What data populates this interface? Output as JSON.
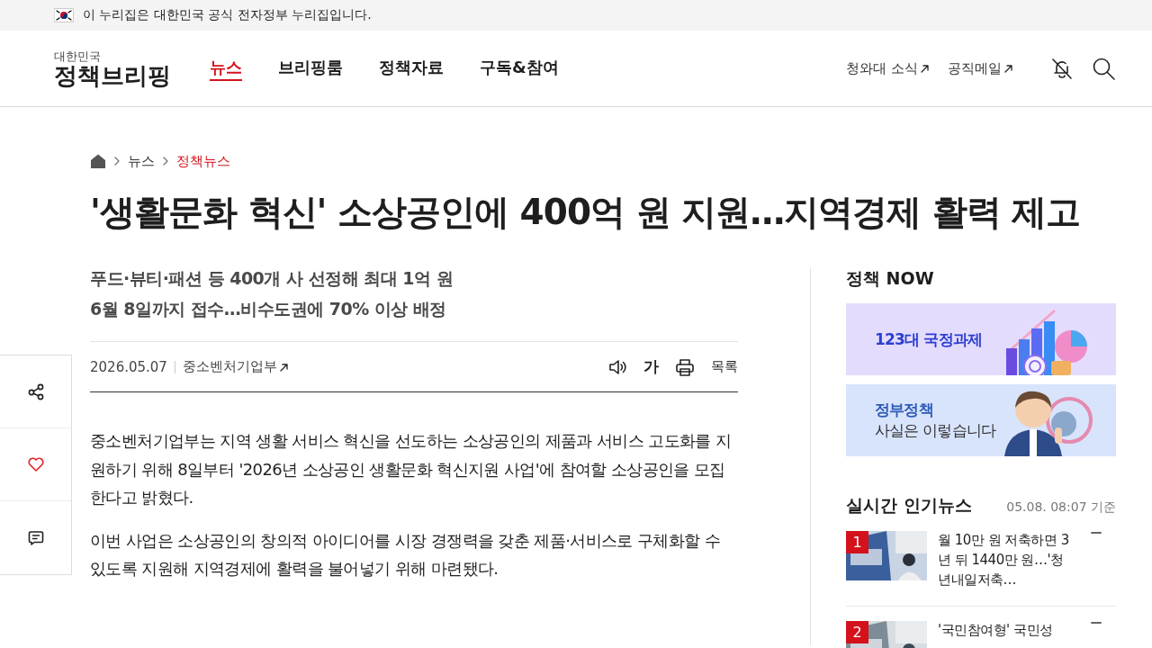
{
  "gov_banner": {
    "text": "이 누리집은 대한민국 공식 전자정부 누리집입니다."
  },
  "logo": {
    "small": "대한민국",
    "main": "정책브리핑"
  },
  "nav": [
    {
      "label": "뉴스",
      "selected": true
    },
    {
      "label": "브리핑룸",
      "selected": false
    },
    {
      "label": "정책자료",
      "selected": false
    },
    {
      "label": "구독&참여",
      "selected": false
    }
  ],
  "utility_links": [
    "청와대 소식",
    "공직메일"
  ],
  "breadcrumb": [
    {
      "label": "뉴스",
      "selected": false
    },
    {
      "label": "정책뉴스",
      "selected": true
    }
  ],
  "headline": "'생활문화 혁신' 소상공인에 400억 원 지원…지역경제 활력 제고",
  "subheadlines": [
    "푸드·뷰티·패션 등 400개 사 선정해 최대 1억 원",
    "6월 8일까지 접수…비수도권에 70% 이상 배정"
  ],
  "meta": {
    "date": "2026.05.07",
    "source": "중소벤처기업부"
  },
  "tools": {
    "font_size": "가",
    "list": "목록"
  },
  "body": [
    "중소벤처기업부는 지역 생활 서비스 혁신을 선도하는 소상공인의 제품과 서비스 고도화를 지원하기 위해 8일부터 '2026년 소상공인 생활문화 혁신지원 사업'에 참여할 소상공인을 모집한다고 밝혔다.",
    "이번 사업은 소상공인의 창의적 아이디어를 시장 경쟁력을 갖춘 제품·서비스로 구체화할 수 있도록 지원해 지역경제에 활력을 불어넣기 위해 마련됐다."
  ],
  "side_actions": [
    {
      "kind": "share"
    },
    {
      "kind": "like"
    },
    {
      "kind": "comment"
    }
  ],
  "sidebar": {
    "now_title": "정책 NOW",
    "banners": [
      {
        "kind": "chart",
        "lines": [
          "123대 국정과제"
        ]
      },
      {
        "kind": "person",
        "lines": [
          "정부정책",
          "사실은 이렇습니다"
        ]
      }
    ],
    "popular": {
      "title": "실시간 인기뉴스",
      "timestamp": "05.08. 08:07 기준",
      "items": [
        {
          "rank": "1",
          "title": "월 10만 원 저축하면 3년 뒤 1440만 원…'청년내일저축…"
        },
        {
          "rank": "2",
          "title": "'국민참여형' 국민성"
        }
      ]
    }
  }
}
